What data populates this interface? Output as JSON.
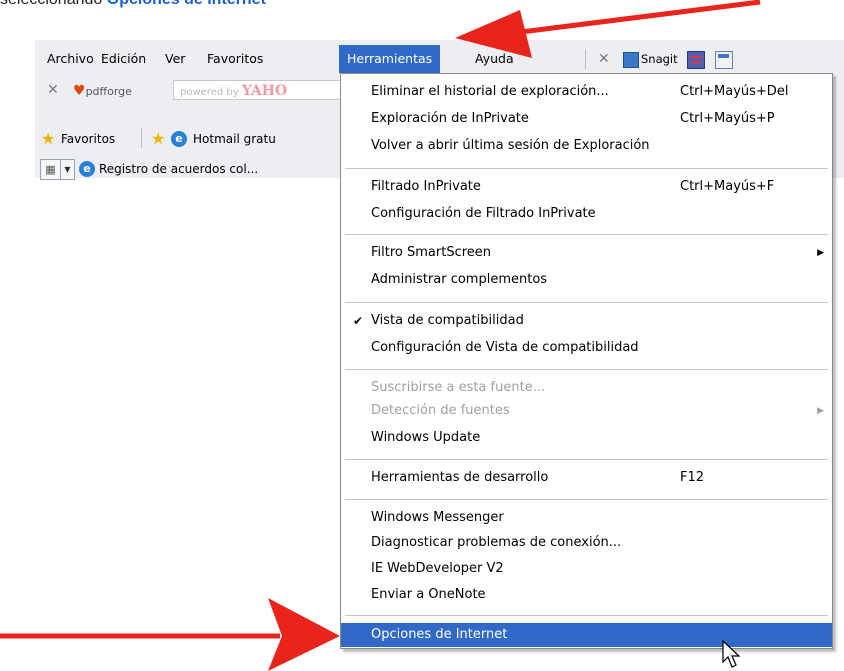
{
  "caption": {
    "prefix": "seleccionando ",
    "highlight": "Opciones de Internet"
  },
  "menubar": {
    "items": [
      "Archivo",
      "Edición",
      "Ver",
      "Favoritos",
      "Herramientas",
      "Ayuda"
    ],
    "active": "Herramientas",
    "snagit": "Snagit"
  },
  "toolbar": {
    "pdfforge": "pdfforge",
    "powered_by": "powered by",
    "yahoo": "YAHO"
  },
  "favorites": {
    "label": "Favoritos",
    "hotmail": "Hotmail gratu"
  },
  "tab": {
    "title": "Registro de acuerdos col..."
  },
  "menu": {
    "items": [
      {
        "label": "Eliminar el historial de exploración...",
        "shortcut": "Ctrl+Mayús+Del"
      },
      {
        "label": "Exploración de InPrivate",
        "shortcut": "Ctrl+Mayús+P"
      },
      {
        "label": "Volver a abrir última sesión de Exploración",
        "shortcut": ""
      },
      {
        "label": "Filtrado InPrivate",
        "shortcut": "Ctrl+Mayús+F"
      },
      {
        "label": "Configuración de Filtrado InPrivate",
        "shortcut": ""
      },
      {
        "label": "Filtro SmartScreen",
        "shortcut": ""
      },
      {
        "label": "Administrar complementos",
        "shortcut": ""
      },
      {
        "label": "Vista de compatibilidad",
        "shortcut": ""
      },
      {
        "label": "Configuración de Vista de compatibilidad",
        "shortcut": ""
      },
      {
        "label": "Suscribirse a esta fuente...",
        "shortcut": ""
      },
      {
        "label": "Detección de fuentes",
        "shortcut": ""
      },
      {
        "label": "Windows Update",
        "shortcut": ""
      },
      {
        "label": "Herramientas de desarrollo",
        "shortcut": "F12"
      },
      {
        "label": "Windows Messenger",
        "shortcut": ""
      },
      {
        "label": "Diagnosticar problemas de conexión...",
        "shortcut": ""
      },
      {
        "label": "IE WebDeveloper V2",
        "shortcut": ""
      },
      {
        "label": "Enviar a OneNote",
        "shortcut": ""
      },
      {
        "label": "Opciones de Internet",
        "shortcut": ""
      }
    ]
  },
  "colors": {
    "highlight": "#3169c6",
    "arrow": "#e8241c",
    "caption_highlight": "#1a5fd6"
  }
}
